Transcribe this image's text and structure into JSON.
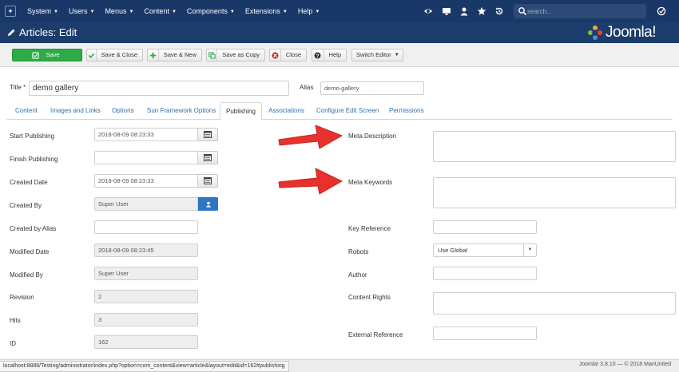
{
  "topnav": {
    "menu": [
      {
        "label": "System"
      },
      {
        "label": "Users"
      },
      {
        "label": "Menus"
      },
      {
        "label": "Content"
      },
      {
        "label": "Components"
      },
      {
        "label": "Extensions"
      },
      {
        "label": "Help"
      }
    ],
    "search_placeholder": "search..."
  },
  "header": {
    "title": "Articles: Edit",
    "brand": "Joomla!"
  },
  "toolbar": {
    "save": "Save",
    "save_close": "Save & Close",
    "save_new": "Save & New",
    "save_copy": "Save as Copy",
    "close": "Close",
    "help": "Help",
    "switch_editor": "Switch Editor"
  },
  "form": {
    "title_label": "Title",
    "title_required": "*",
    "title_value": "demo gallery",
    "alias_label": "Alias",
    "alias_value": "demo-gallery"
  },
  "tabs": [
    {
      "label": "Content"
    },
    {
      "label": "Images and Links"
    },
    {
      "label": "Options"
    },
    {
      "label": "Sun Framework Options"
    },
    {
      "label": "Publishing"
    },
    {
      "label": "Associations"
    },
    {
      "label": "Configure Edit Screen"
    },
    {
      "label": "Permissions"
    }
  ],
  "publishing": {
    "start_publishing": {
      "label": "Start Publishing",
      "value": "2018-08-09 08:23:33"
    },
    "finish_publishing": {
      "label": "Finish Publishing",
      "value": ""
    },
    "created_date": {
      "label": "Created Date",
      "value": "2018-08-09 08:23:33"
    },
    "created_by": {
      "label": "Created By",
      "value": "Super User"
    },
    "created_by_alias": {
      "label": "Created by Alias",
      "value": ""
    },
    "modified_date": {
      "label": "Modified Date",
      "value": "2018-08-09 08:23:45"
    },
    "modified_by": {
      "label": "Modified By",
      "value": "Super User"
    },
    "revision": {
      "label": "Revision",
      "value": "2"
    },
    "hits": {
      "label": "Hits",
      "value": "3"
    },
    "id": {
      "label": "ID",
      "value": "162"
    }
  },
  "metadata": {
    "meta_description": {
      "label": "Meta Description",
      "value": ""
    },
    "meta_keywords": {
      "label": "Meta Keywords",
      "value": ""
    },
    "key_reference": {
      "label": "Key Reference",
      "value": ""
    },
    "robots": {
      "label": "Robots",
      "value": "Use Global"
    },
    "author": {
      "label": "Author",
      "value": ""
    },
    "content_rights": {
      "label": "Content Rights",
      "value": ""
    },
    "external_reference": {
      "label": "External Reference",
      "value": ""
    }
  },
  "statusbar": {
    "url": "localhost:8888/Testing/administrator/index.php?option=com_content&view=article&layout=edit&id=162#publishing",
    "footer": "Joomla! 3.8.10  —  © 2018 ManUnited"
  },
  "colors": {
    "nav_bg": "#1a3867",
    "title_bg": "#1c3d6c",
    "save_green": "#2eaa49",
    "link_blue": "#3071a9",
    "annotation_red": "#e8302d"
  }
}
